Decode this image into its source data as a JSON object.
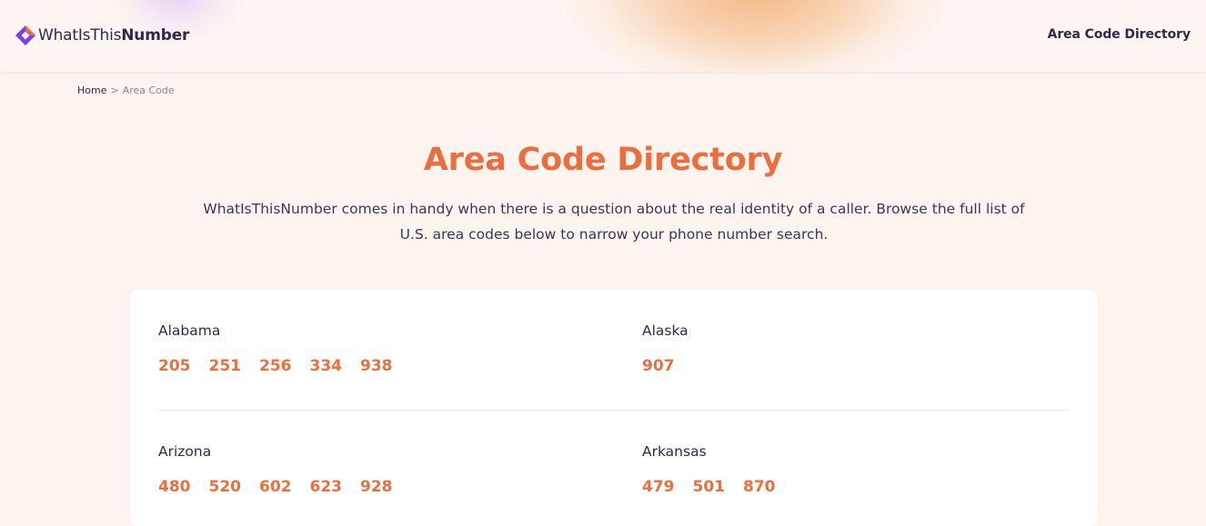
{
  "header": {
    "logo_text_light": "WhatIsThis",
    "logo_text_bold": "Number",
    "nav_link": "Area Code Directory",
    "brand_colors": {
      "purple": "#7b3fe4",
      "orange": "#ea6f3e"
    }
  },
  "breadcrumb": {
    "home": "Home",
    "separator": ">",
    "current": "Area Code"
  },
  "main": {
    "title": "Area Code Directory",
    "intro_line1": "WhatIsThisNumber comes in handy when there is a question about the real identity of a caller. Browse the full list of",
    "intro_line2": "U.S. area codes below to narrow your phone number search."
  },
  "states": [
    {
      "name": "Alabama",
      "codes": [
        "205",
        "251",
        "256",
        "334",
        "938"
      ]
    },
    {
      "name": "Alaska",
      "codes": [
        "907"
      ]
    },
    {
      "name": "Arizona",
      "codes": [
        "480",
        "520",
        "602",
        "623",
        "928"
      ]
    },
    {
      "name": "Arkansas",
      "codes": [
        "479",
        "501",
        "870"
      ]
    }
  ]
}
